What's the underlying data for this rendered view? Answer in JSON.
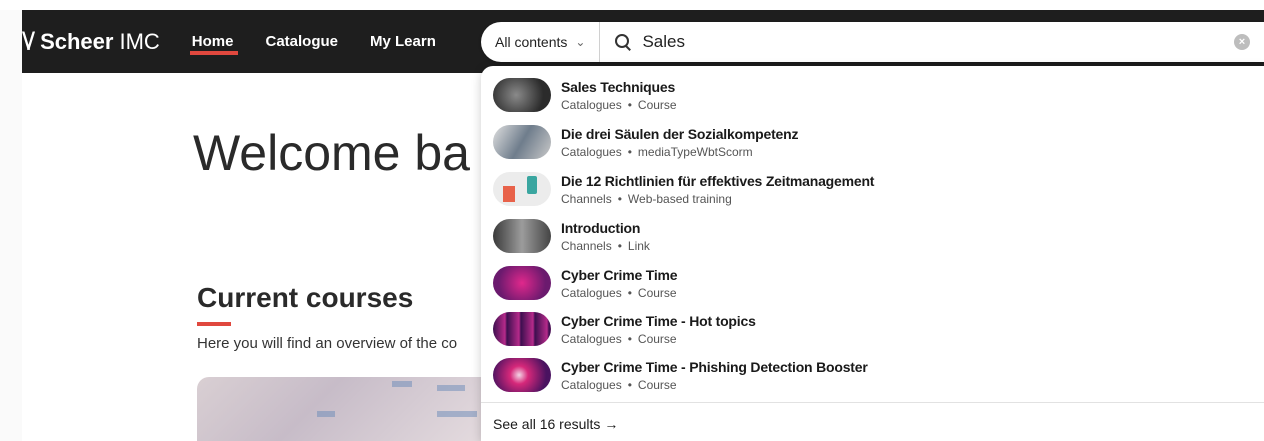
{
  "header": {
    "logo_mark": "\\/",
    "logo_bold": "Scheer",
    "logo_light": "IMC",
    "nav": [
      {
        "label": "Home",
        "active": true
      },
      {
        "label": "Catalogue",
        "active": false
      },
      {
        "label": "My Learn",
        "active": false
      }
    ]
  },
  "main": {
    "welcome": "Welcome ba",
    "courses_title": "Current courses",
    "courses_subtitle": "Here you will find an overview of the co"
  },
  "search": {
    "scope": "All contents",
    "value": "Sales",
    "clear_icon": "clear-icon",
    "results": [
      {
        "title": "Sales Techniques",
        "source": "Catalogues",
        "type": "Course",
        "thumb_colors": [
          "#2b2b2b",
          "#8a8a8a"
        ]
      },
      {
        "title": "Die drei Säulen der Sozialkompetenz",
        "source": "Catalogues",
        "type": "mediaTypeWbtScorm",
        "thumb_colors": [
          "#c9c9c9",
          "#6f7d8c"
        ]
      },
      {
        "title": "Die 12 Richtlinien für effektives Zeitmanagement",
        "source": "Channels",
        "type": "Web-based training",
        "thumb_colors": [
          "#ececec",
          "#e8624a"
        ]
      },
      {
        "title": "Introduction",
        "source": "Channels",
        "type": "Link",
        "thumb_colors": [
          "#3a3a3a",
          "#9c9c9c"
        ]
      },
      {
        "title": "Cyber Crime Time",
        "source": "Catalogues",
        "type": "Course",
        "thumb_colors": [
          "#6b1a6e",
          "#e0288c"
        ]
      },
      {
        "title": "Cyber Crime Time - Hot topics",
        "source": "Catalogues",
        "type": "Course",
        "thumb_colors": [
          "#3d0f4f",
          "#b52a8a"
        ]
      },
      {
        "title": "Cyber Crime Time - Phishing Detection Booster",
        "source": "Catalogues",
        "type": "Course",
        "thumb_colors": [
          "#4a1260",
          "#d6287a"
        ]
      }
    ],
    "see_all": "See all 16 results",
    "see_all_arrow": "→"
  },
  "colors": {
    "topbar": "#1e1e1e",
    "accent": "#e0483e"
  }
}
